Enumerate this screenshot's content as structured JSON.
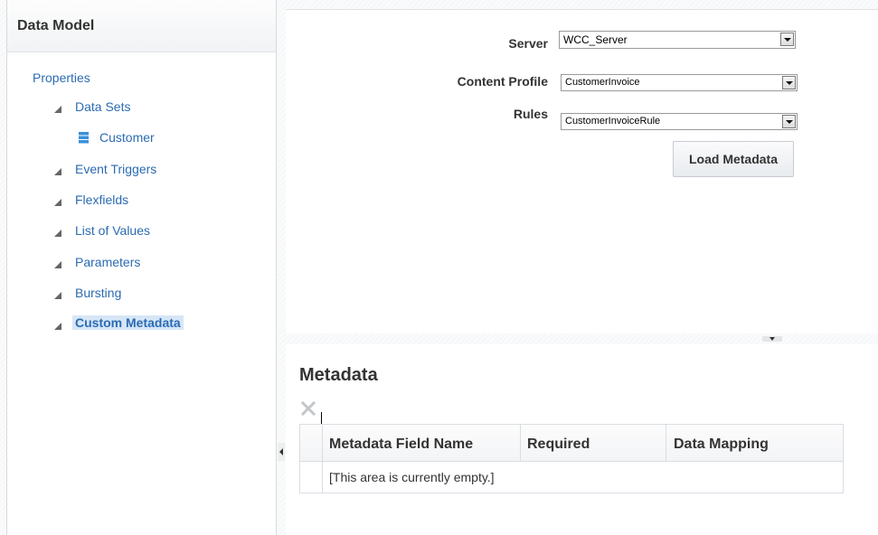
{
  "left_panel": {
    "title": "Data Model",
    "properties_link": "Properties",
    "tree": [
      {
        "label": "Data Sets"
      },
      {
        "label": "Customer",
        "icon": "database-icon"
      },
      {
        "label": "Event Triggers"
      },
      {
        "label": "Flexfields"
      },
      {
        "label": "List of Values"
      },
      {
        "label": "Parameters"
      },
      {
        "label": "Bursting"
      },
      {
        "label": "Custom Metadata",
        "selected": true
      }
    ]
  },
  "form": {
    "server_label": "Server",
    "server_value": "WCC_Server",
    "profile_label": "Content Profile",
    "profile_value": "CustomerInvoice",
    "rules_label": "Rules",
    "rules_value": "CustomerInvoiceRule",
    "load_button": "Load Metadata"
  },
  "metadata": {
    "title": "Metadata",
    "columns": [
      "Metadata Field Name",
      "Required",
      "Data Mapping"
    ],
    "empty_text": "[This area is currently empty.]"
  },
  "colors": {
    "link": "#2b6bb2",
    "selected_bg": "#d6e6f7",
    "db_icon": "#3a8fd9"
  }
}
